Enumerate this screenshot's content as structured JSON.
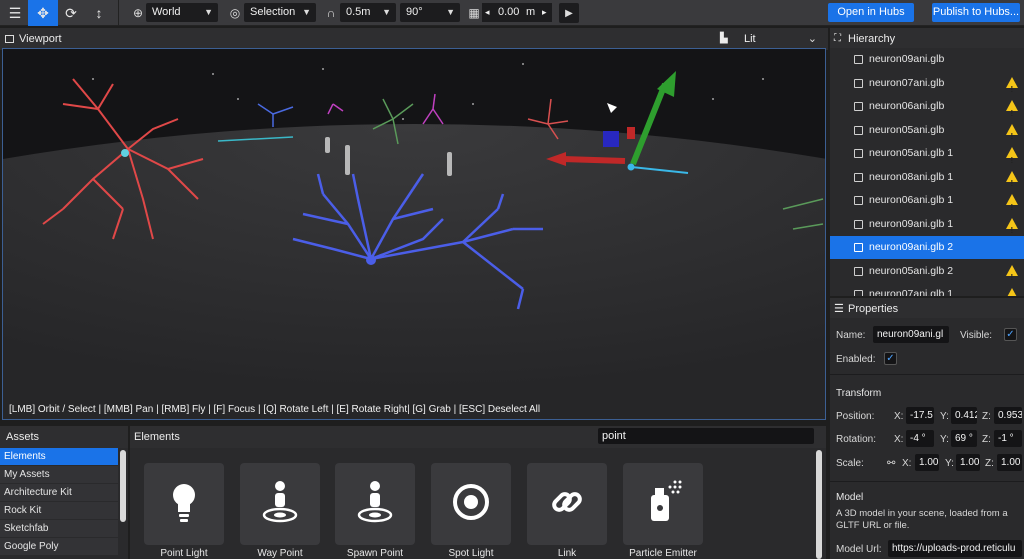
{
  "toolbar": {
    "space": "World",
    "snap_mode": "Selection",
    "snap_distance": "0.5m",
    "snap_angle": "90°",
    "grid_value": "0.00",
    "grid_unit": "m",
    "open_in_hubs": "Open in Hubs",
    "publish": "Publish to Hubs..."
  },
  "viewport": {
    "title": "Viewport",
    "render_mode": "Lit",
    "status": "[LMB] Orbit / Select | [MMB] Pan | [RMB] Fly | [F] Focus | [Q] Rotate Left | [E] Rotate Right| [G] Grab | [ESC] Deselect All"
  },
  "hierarchy": {
    "title": "Hierarchy",
    "items": [
      {
        "label": "neuron09ani.glb",
        "warning": false,
        "selected": false
      },
      {
        "label": "neuron07ani.glb",
        "warning": true,
        "selected": false
      },
      {
        "label": "neuron06ani.glb",
        "warning": true,
        "selected": false
      },
      {
        "label": "neuron05ani.glb",
        "warning": true,
        "selected": false
      },
      {
        "label": "neuron05ani.glb 1",
        "warning": true,
        "selected": false
      },
      {
        "label": "neuron08ani.glb 1",
        "warning": true,
        "selected": false
      },
      {
        "label": "neuron06ani.glb 1",
        "warning": true,
        "selected": false
      },
      {
        "label": "neuron09ani.glb 1",
        "warning": true,
        "selected": false
      },
      {
        "label": "neuron09ani.glb 2",
        "warning": false,
        "selected": true
      },
      {
        "label": "neuron05ani.glb 2",
        "warning": true,
        "selected": false
      },
      {
        "label": "neuron07ani.glb 1",
        "warning": true,
        "selected": false
      }
    ]
  },
  "properties": {
    "title": "Properties",
    "name_label": "Name:",
    "name_value": "neuron09ani.gl",
    "visible_label": "Visible:",
    "enabled_label": "Enabled:",
    "check": "✓",
    "transform_title": "Transform",
    "position_label": "Position:",
    "rotation_label": "Rotation:",
    "scale_label": "Scale:",
    "x": "X:",
    "y": "Y:",
    "z": "Z:",
    "position": {
      "x": "-17.5",
      "y": "0.412",
      "z": "0.953"
    },
    "rotation": {
      "x": "-4 °",
      "y": "69 °",
      "z": "-1 °"
    },
    "scale": {
      "x": "1.00",
      "y": "1.00",
      "z": "1.00"
    },
    "model_title": "Model",
    "model_desc": "A 3D model in your scene, loaded from a GLTF URL or file.",
    "model_url_label": "Model Url:",
    "model_url_value": "https://uploads-prod.reticulu"
  },
  "assets": {
    "title": "Assets",
    "items": [
      "Elements",
      "My Assets",
      "Architecture Kit",
      "Rock Kit",
      "Sketchfab",
      "Google Poly"
    ]
  },
  "elements": {
    "title": "Elements",
    "search_value": "point",
    "cards": [
      {
        "label": "Point Light",
        "icon": "lightbulb-icon"
      },
      {
        "label": "Way Point",
        "icon": "waypoint-icon"
      },
      {
        "label": "Spawn Point",
        "icon": "spawn-point-icon"
      },
      {
        "label": "Spot Light",
        "icon": "spotlight-icon"
      },
      {
        "label": "Link",
        "icon": "link-icon"
      },
      {
        "label": "Particle Emitter",
        "icon": "particle-emitter-icon"
      }
    ]
  },
  "colors": {
    "accent": "#1a73e8",
    "warning": "#f5c518"
  }
}
